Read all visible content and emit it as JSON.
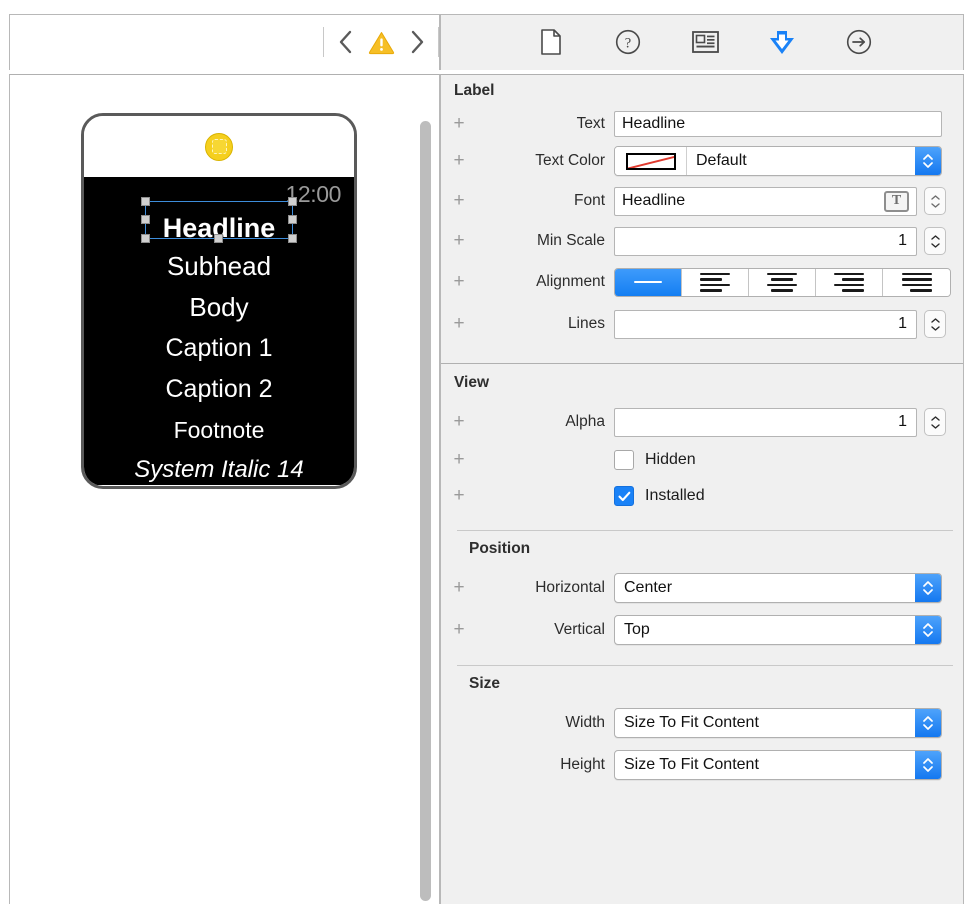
{
  "toolbar": {
    "nav_back": "‹",
    "nav_forward": "›",
    "warning_icon": "warning-triangle-icon",
    "inspector_tabs": [
      {
        "name": "file-inspector",
        "icon": "document-icon"
      },
      {
        "name": "quick-help-inspector",
        "icon": "question-circle-icon"
      },
      {
        "name": "identity-inspector",
        "icon": "id-card-icon"
      },
      {
        "name": "attributes-inspector",
        "icon": "down-arrow-badge-icon",
        "selected": true
      },
      {
        "name": "connections-inspector",
        "icon": "arrow-right-circle-icon"
      }
    ]
  },
  "canvas": {
    "watch": {
      "status_time": "12:00",
      "badge_icon": "selected-group-badge-icon",
      "rows": [
        {
          "text": "Headline",
          "style": "headline",
          "selected": true
        },
        {
          "text": "Subhead",
          "style": "subhead",
          "selected": false
        },
        {
          "text": "Body",
          "style": "body",
          "selected": false
        },
        {
          "text": "Caption 1",
          "style": "caption1",
          "selected": false
        },
        {
          "text": "Caption 2",
          "style": "caption2",
          "selected": false
        },
        {
          "text": "Footnote",
          "style": "footnote",
          "selected": false
        },
        {
          "text": "System Italic 14",
          "style": "italic",
          "selected": false
        }
      ]
    }
  },
  "inspector": {
    "label_section": {
      "title": "Label",
      "text": {
        "label": "Text",
        "value": "Headline"
      },
      "text_color": {
        "label": "Text Color",
        "value": "Default",
        "swatch": "none-color-swatch"
      },
      "font": {
        "label": "Font",
        "value": "Headline",
        "button_glyph": "T"
      },
      "min_scale": {
        "label": "Min Scale",
        "value": "1"
      },
      "alignment": {
        "label": "Alignment",
        "selected_index": 0,
        "options": [
          "Default",
          "Left",
          "Center",
          "Right",
          "Justified"
        ]
      },
      "lines": {
        "label": "Lines",
        "value": "1"
      }
    },
    "view_section": {
      "title": "View",
      "alpha": {
        "label": "Alpha",
        "value": "1"
      },
      "hidden": {
        "label": "Hidden",
        "checked": false
      },
      "installed": {
        "label": "Installed",
        "checked": true
      }
    },
    "position_section": {
      "title": "Position",
      "horizontal": {
        "label": "Horizontal",
        "value": "Center"
      },
      "vertical": {
        "label": "Vertical",
        "value": "Top"
      }
    },
    "size_section": {
      "title": "Size",
      "width": {
        "label": "Width",
        "value": "Size To Fit Content"
      },
      "height": {
        "label": "Height",
        "value": "Size To Fit Content"
      }
    },
    "add_variation_symbol": "+"
  },
  "colors": {
    "accent_blue": "#1a82f7",
    "warning_yellow": "#f5b823",
    "panel_bg": "#f0f0f0",
    "screen_black": "#000000"
  }
}
